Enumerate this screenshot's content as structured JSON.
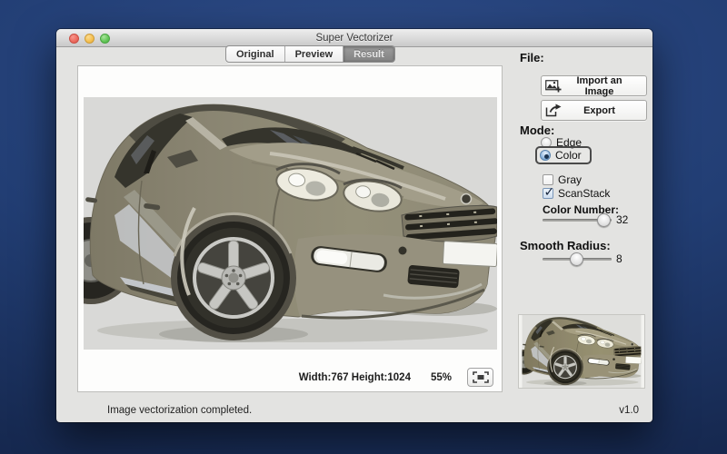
{
  "window": {
    "title": "Super Vectorizer"
  },
  "tabs": [
    {
      "label": "Original",
      "selected": false
    },
    {
      "label": "Preview",
      "selected": false
    },
    {
      "label": "Result",
      "selected": true
    }
  ],
  "file_section": {
    "label": "File:",
    "import_label": "Import an Image",
    "export_label": "Export"
  },
  "mode_section": {
    "label": "Mode:",
    "options": [
      {
        "label": "Edge",
        "selected": false
      },
      {
        "label": "Color",
        "selected": true
      }
    ],
    "gray_checkbox": {
      "label": "Gray",
      "checked": false
    },
    "scanstack_checkbox": {
      "label": "ScanStack",
      "checked": true
    },
    "color_number": {
      "label": "Color Number:",
      "value": "32"
    }
  },
  "smooth_radius": {
    "label": "Smooth Radius:",
    "value": "8"
  },
  "image_info": {
    "dimensions": "Width:767 Height:1024",
    "zoom": "55%"
  },
  "status_bar": {
    "message": "Image vectorization completed.",
    "version": "v1.0"
  },
  "icons": {
    "import": "image-plus-icon",
    "export": "arrow-out-icon",
    "fit": "fit-to-window-icon"
  },
  "colors": {
    "desktop_blue": "#223e74",
    "window_gray": "#e3e3e1",
    "selected_tab": "#8a8a8a",
    "radio_blue": "#6a9cc9",
    "highlight_ring": "#4a4a4a",
    "car_body_khaki": "#8d8773",
    "image_background": "#d9d9d7"
  }
}
